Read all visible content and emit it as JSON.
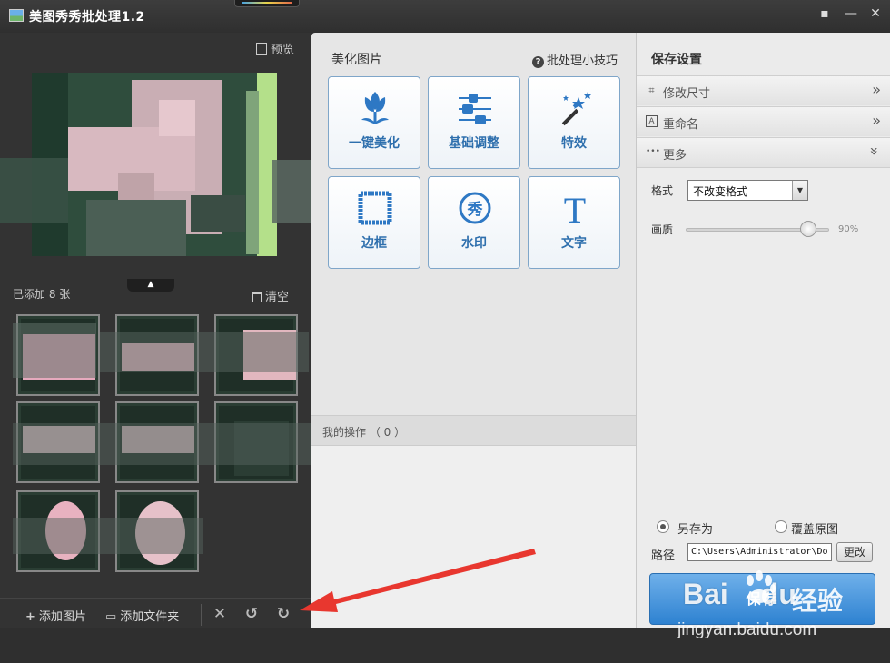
{
  "window": {
    "title": "美图秀秀批处理1.2"
  },
  "left_panel": {
    "preview_label": "预览",
    "added_count": "已添加 8 张",
    "clear_label": "清空",
    "toolbar": {
      "add_image": "添加图片",
      "add_folder": "添加文件夹"
    }
  },
  "middle_panel": {
    "heading": "美化图片",
    "tips_link": "批处理小技巧",
    "tools": [
      {
        "label": "一键美化",
        "icon": "tulip-icon"
      },
      {
        "label": "基础调整",
        "icon": "sliders-icon"
      },
      {
        "label": "特效",
        "icon": "magic-wand-icon"
      },
      {
        "label": "边框",
        "icon": "frame-icon"
      },
      {
        "label": "水印",
        "icon": "watermark-icon",
        "glyph": "秀"
      },
      {
        "label": "文字",
        "icon": "text-icon",
        "glyph": "T"
      }
    ],
    "operations_label": "我的操作 （ 0 ）"
  },
  "right_panel": {
    "heading": "保存设置",
    "sections": [
      {
        "label": "修改尺寸",
        "icon": "crop-icon",
        "icon_glyph": "⌗",
        "expanded": false
      },
      {
        "label": "重命名",
        "icon": "rename-icon",
        "icon_glyph": "A",
        "expanded": false
      },
      {
        "label": "更多",
        "icon": "more-icon",
        "icon_glyph": "•••",
        "expanded": true
      }
    ],
    "format_label": "格式",
    "format_value": "不改变格式",
    "quality_label": "画质",
    "quality_value": "90%",
    "quality_level": 0.9,
    "save_as_label": "另存为",
    "overwrite_label": "覆盖原图",
    "save_mode": "save_as",
    "path_label": "路径",
    "path_value": "C:\\Users\\Administrator\\Do",
    "change_label": "更改",
    "save_label": "保存"
  },
  "colors": {
    "accent_blue": "#2e6fad",
    "save_button": "#3a8ad6",
    "arrow_red": "#e8372f"
  },
  "watermark": {
    "brand": "Bai",
    "brand_suffix": "du",
    "cn": "经验",
    "url": "jingyan.baidu.com"
  }
}
